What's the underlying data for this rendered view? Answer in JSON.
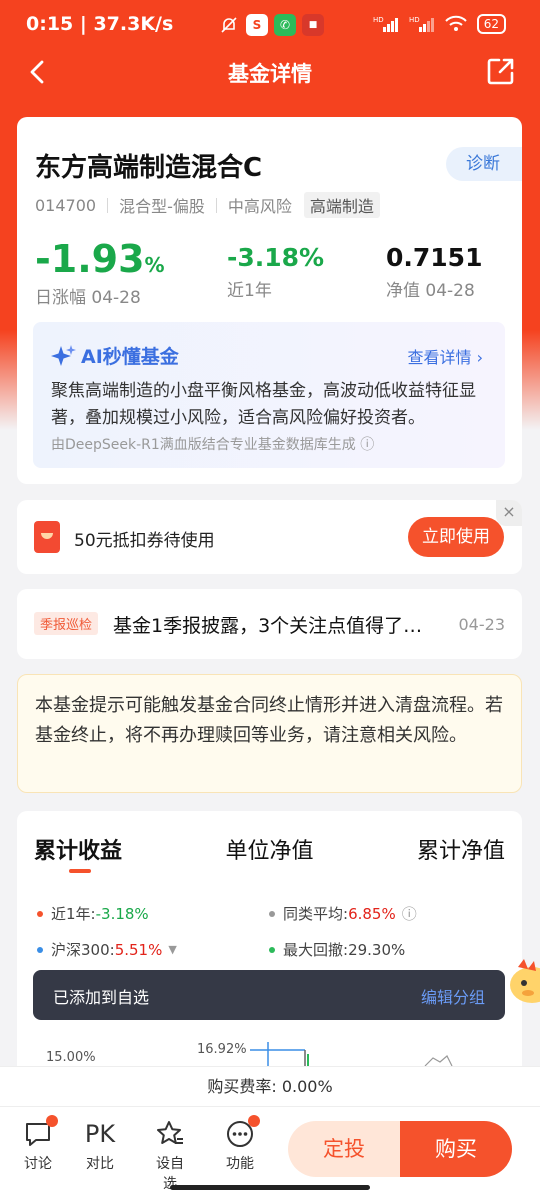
{
  "status_bar": {
    "time": "0:15",
    "speed": "37.3K/s",
    "battery": "62"
  },
  "nav": {
    "title": "基金详情"
  },
  "fund": {
    "name": "东方高端制造混合C",
    "diagnose_label": "诊断",
    "code": "014700",
    "type": "混合型-偏股",
    "risk": "中高风险",
    "theme_tag": "高端制造",
    "daily_change": "-1.93",
    "daily_change_unit": "%",
    "daily_label": "日涨幅 04-28",
    "year_change": "-3.18%",
    "year_label": "近1年",
    "nav_value": "0.7151",
    "nav_label": "净值 04-28"
  },
  "ai": {
    "title": "AI秒懂基金",
    "more": "查看详情",
    "summary": "聚焦高端制造的小盘平衡风格基金，高波动低收益特征显著，叠加规模过小风险，适合高风险偏好投资者。",
    "source": "由DeepSeek-R1满血版结合专业基金数据库生成"
  },
  "coupon": {
    "text": "50元抵扣券待使用",
    "button": "立即使用",
    "close": "×"
  },
  "news": {
    "tag": "季报巡检",
    "title": "基金1季报披露，3个关注点值得了…",
    "date": "04-23"
  },
  "warning": {
    "text": "本基金提示可能触发基金合同终止情形并进入清盘流程。若基金终止，将不再办理赎回等业务，请注意相关风险。"
  },
  "chart_tabs": {
    "tab1": "累计收益",
    "tab2": "单位净值",
    "tab3": "累计净值"
  },
  "stats": {
    "year_label": "近1年:",
    "year_value": "-3.18%",
    "peer_label": "同类平均:",
    "peer_value": "6.85%",
    "hs300_label": "沪深300:",
    "hs300_value": "5.51%",
    "drawdown_label": "最大回撤:",
    "drawdown_value": "29.30%"
  },
  "toast": {
    "text": "已添加到自选",
    "link": "编辑分组"
  },
  "chart_preview": {
    "y_label": "15.00%",
    "peak_label": "16.92%"
  },
  "fee": {
    "text": "购买费率: 0.00%"
  },
  "bottom": {
    "discuss": "讨论",
    "compare_icon": "PK",
    "compare": "对比",
    "watch": "设自选",
    "functions": "功能",
    "fixed_invest": "定投",
    "buy": "购买"
  },
  "colors": {
    "brand": "#f5421f",
    "down": "#1aa84a",
    "up": "#e2231a",
    "ai_blue": "#3b6fe0"
  }
}
